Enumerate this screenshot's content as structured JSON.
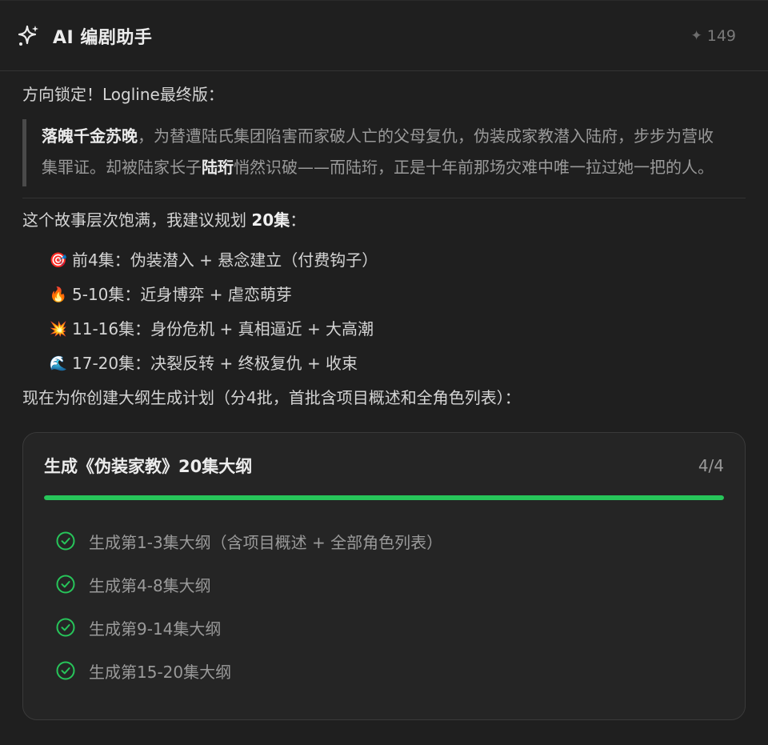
{
  "header": {
    "title": "AI 编剧助手",
    "credits_icon": "sparkle-icon",
    "credits": "149"
  },
  "message": {
    "intro": "方向锁定！Logline最终版：",
    "quote": {
      "name": "落魄千金苏晚",
      "part1": "，为替遭陆氏集团陷害而家破人亡的父母复仇，伪装成家教潜入陆府，步步为营收集罪证。却被陆家长子",
      "lu": "陆珩",
      "part2": "悄然识破——而陆珩，正是十年前那场灾难中唯一拉过她一把的人。"
    },
    "plan_prefix": "这个故事层次饱满，我建议规划 ",
    "plan_bold": "20集",
    "plan_suffix": "：",
    "phases": [
      {
        "emoji": "🎯",
        "text": "前4集：伪装潜入 + 悬念建立（付费钩子）"
      },
      {
        "emoji": "🔥",
        "text": "5-10集：近身博弈 + 虐恋萌芽"
      },
      {
        "emoji": "💥",
        "text": "11-16集：身份危机 + 真相逼近 + 大高潮"
      },
      {
        "emoji": "🌊",
        "text": "17-20集：决裂反转 + 终极复仇 + 收束"
      }
    ],
    "closing": "现在为你创建大纲生成计划（分4批，首批含项目概述和全角色列表）："
  },
  "plan_card": {
    "title": "生成《伪装家教》20集大纲",
    "count": "4/4",
    "progress": 1.0,
    "accent": "#27c55a",
    "tasks": [
      {
        "label": "生成第1-3集大纲（含项目概述 + 全部角色列表）",
        "status": "done"
      },
      {
        "label": "生成第4-8集大纲",
        "status": "done"
      },
      {
        "label": "生成第9-14集大纲",
        "status": "done"
      },
      {
        "label": "生成第15-20集大纲",
        "status": "done"
      }
    ]
  }
}
